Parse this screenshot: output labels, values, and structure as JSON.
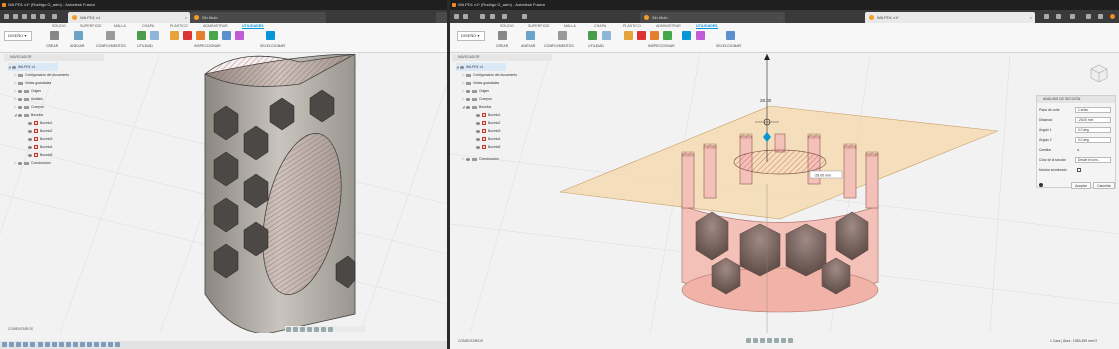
{
  "left": {
    "title": "WA PD1 v1* (Rodrigo G_adm) - Autodesk Fusion",
    "tab": "WA PD1 v1",
    "tab_inactive": "Sin título",
    "ribbon_tabs": [
      "SÓLIDO",
      "SUPERFICIE",
      "MALLA",
      "CHAPA",
      "PLÁSTICO",
      "ADMINISTRAR",
      "UTILIDADES"
    ],
    "active_tab": "UTILIDADES",
    "workspace": "DISEÑO",
    "groups": [
      "CREAR",
      "ANEXAR",
      "COMPLEMENTOS",
      "UTILIDAD",
      "INSPECCIONAR",
      "SELECCIONAR"
    ],
    "navigator": "NAVEGADOR",
    "tree": [
      "WA PD1 v1",
      "Configuración del documento",
      "Vistas guardadas",
      "Origen",
      "Análisis",
      "Cuerpos",
      "Bocetos",
      "Boceto1",
      "Boceto2",
      "Boceto3",
      "Boceto4",
      "Boceto5",
      "Construcción"
    ],
    "comments": "COMENTARIOS"
  },
  "right": {
    "title": "WA PD1 v1* (Rodrigo G_adm) - Autodesk Fusion",
    "tab": "WA PD1 v1*",
    "tab_inactive": "Sin título",
    "ribbon_tabs": [
      "SÓLIDO",
      "SUPERFICIE",
      "MALLA",
      "CHAPA",
      "PLÁSTICO",
      "ADMINISTRAR",
      "UTILIDADES"
    ],
    "active_tab": "UTILIDADES",
    "workspace": "DISEÑO",
    "groups": [
      "CREAR",
      "ANEXAR",
      "COMPLEMENTOS",
      "UTILIDAD",
      "INSPECCIONAR",
      "SELECCIONAR"
    ],
    "navigator": "NAVEGADOR",
    "tree": [
      "WA PD1 v1",
      "Configuración del documento",
      "Vistas guardadas",
      "Origen",
      "Cuerpos",
      "Bocetos",
      "Boceto1",
      "Boceto2",
      "Boceto3",
      "Boceto4",
      "Boceto5",
      "Construcción"
    ],
    "comments": "COMENTARIOS",
    "section_panel": {
      "title": "ANÁLISIS DE SECCIÓN",
      "rows": [
        {
          "label": "Plano de corte",
          "value": "1 selec."
        },
        {
          "label": "Distancia",
          "value": "-28.00 mm"
        },
        {
          "label": "Ángulo 1",
          "value": "0.0 deg"
        },
        {
          "label": "Ángulo 2",
          "value": "0.0 deg"
        },
        {
          "label": "Cambiar",
          "value": ""
        },
        {
          "label": "Color de la sección",
          "value": "Desde el com..."
        },
        {
          "label": "Mostrar sombreado",
          "value": ""
        }
      ],
      "ok": "Aceptar",
      "cancel": "Cancelar"
    },
    "dimension": "28.00",
    "distance_input": "-28.00 mm",
    "status": "1 Cara | Área : 1963.495 mm^2"
  },
  "colors": {
    "accent": "#0696d7",
    "body_pink": "#f4c1b8",
    "body_grey": "#b9b4ae",
    "plane": "#f4d7a8"
  }
}
